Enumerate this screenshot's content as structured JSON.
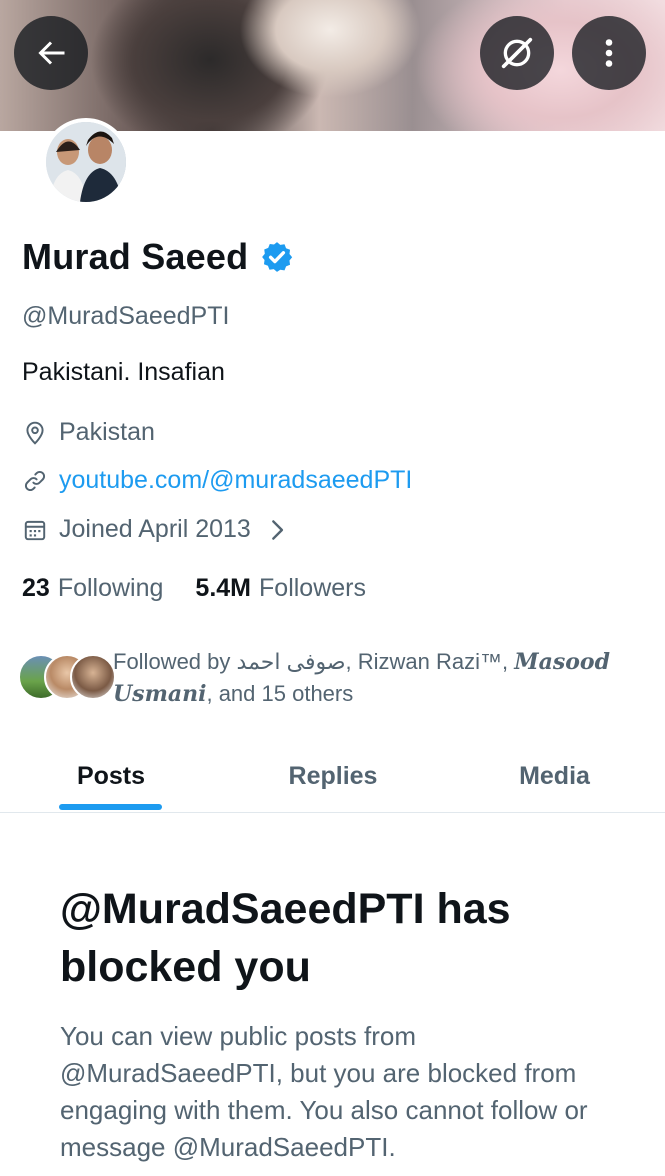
{
  "header": {
    "back_icon": "arrow-left-icon",
    "grok_icon": "grok-icon",
    "more_icon": "more-vertical-icon"
  },
  "profile": {
    "name": "Murad Saeed",
    "verified_icon": "verified-badge-icon",
    "handle": "@MuradSaeedPTI",
    "bio": "Pakistani. Insafian",
    "location": "Pakistan",
    "website": "youtube.com/@muradsaeedPTI",
    "joined": "Joined April 2013"
  },
  "stats": {
    "following_count": "23",
    "following_label": "Following",
    "followers_count": "5.4M",
    "followers_label": "Followers"
  },
  "followed_by": {
    "prefix": "Followed by ",
    "name1": "صوفی احمد",
    "sep1": ", ",
    "name2": "Rizwan Razi™",
    "sep2": ", ",
    "name3": "Masood Usmani",
    "suffix": ", and 15 others"
  },
  "tabs": [
    {
      "label": "Posts",
      "active": true
    },
    {
      "label": "Replies",
      "active": false
    },
    {
      "label": "Media",
      "active": false
    }
  ],
  "blocked": {
    "title": "@MuradSaeedPTI has blocked you",
    "body": "You can view public posts from @MuradSaeedPTI, but you are blocked from engaging with them. You also cannot follow or message @MuradSaeedPTI."
  },
  "colors": {
    "accent": "#1d9bf0",
    "text_primary": "#0f1419",
    "text_secondary": "#536471"
  }
}
